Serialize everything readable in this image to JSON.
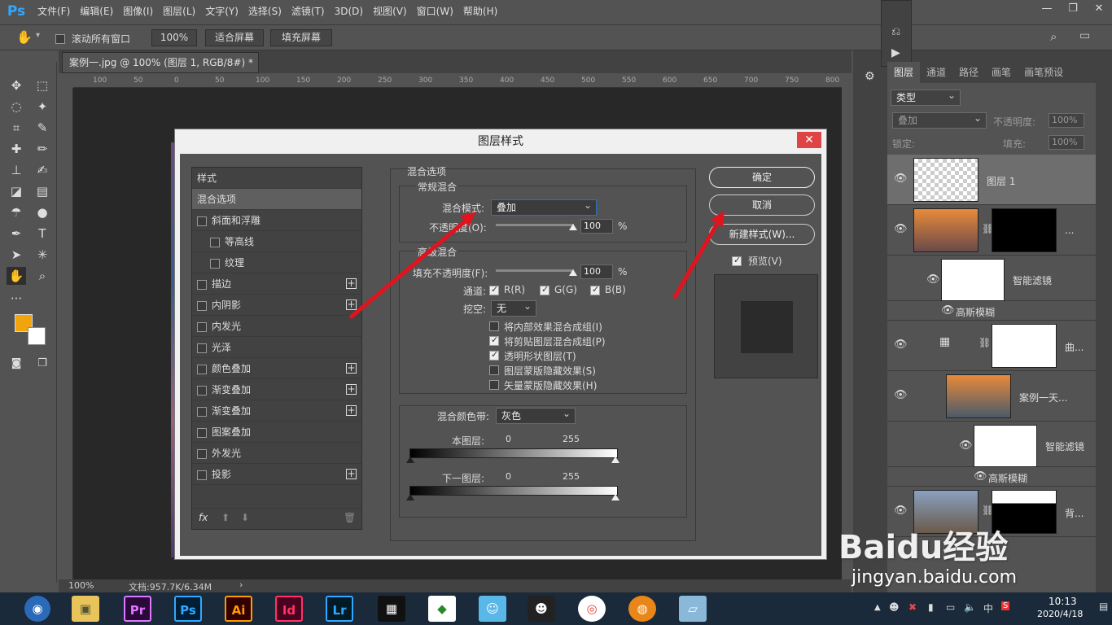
{
  "app": {
    "logo": "Ps",
    "menu": [
      "文件(F)",
      "编辑(E)",
      "图像(I)",
      "图层(L)",
      "文字(Y)",
      "选择(S)",
      "滤镜(T)",
      "3D(D)",
      "视图(V)",
      "窗口(W)",
      "帮助(H)"
    ]
  },
  "options": {
    "scroll_all": "滚动所有窗口",
    "zoom": "100%",
    "fit_screen": "适合屏幕",
    "fill_screen": "填充屏幕"
  },
  "document": {
    "tab": "案例一.jpg @ 100% (图层 1, RGB/8#) *",
    "zoom": "100%",
    "doc_size": "文档:957.7K/6.34M",
    "ruler": [
      "100",
      "50",
      "0",
      "50",
      "100",
      "150",
      "200",
      "250",
      "300",
      "350",
      "400",
      "450",
      "500",
      "550",
      "600",
      "650",
      "700",
      "750",
      "800"
    ]
  },
  "dialog": {
    "title": "图层样式",
    "close": "✕",
    "styles_header": "样式",
    "style_items": [
      {
        "label": "混合选项",
        "checkbox": false,
        "plus": false
      },
      {
        "label": "斜面和浮雕",
        "checkbox": true,
        "plus": false
      },
      {
        "label": "等高线",
        "checkbox": true,
        "plus": false
      },
      {
        "label": "纹理",
        "checkbox": true,
        "plus": false
      },
      {
        "label": "描边",
        "checkbox": true,
        "plus": true
      },
      {
        "label": "内阴影",
        "checkbox": true,
        "plus": true
      },
      {
        "label": "内发光",
        "checkbox": true,
        "plus": false
      },
      {
        "label": "光泽",
        "checkbox": true,
        "plus": false
      },
      {
        "label": "颜色叠加",
        "checkbox": true,
        "plus": true
      },
      {
        "label": "渐变叠加",
        "checkbox": true,
        "plus": true
      },
      {
        "label": "渐变叠加",
        "checkbox": true,
        "plus": true
      },
      {
        "label": "图案叠加",
        "checkbox": true,
        "plus": false
      },
      {
        "label": "外发光",
        "checkbox": true,
        "plus": false
      },
      {
        "label": "投影",
        "checkbox": true,
        "plus": true
      }
    ],
    "blend": {
      "section": "混合选项",
      "general": "常规混合",
      "mode_label": "混合模式:",
      "mode_value": "叠加",
      "opacity_label": "不透明度(O):",
      "opacity_value": "100",
      "percent": "%",
      "advanced": "高级混合",
      "fill_label": "填充不透明度(F):",
      "fill_value": "100",
      "channels_label": "通道:",
      "channel_r": "R(R)",
      "channel_g": "G(G)",
      "channel_b": "B(B)",
      "knockout_label": "挖空:",
      "knockout_value": "无",
      "opt1": "将内部效果混合成组(I)",
      "opt2": "将剪贴图层混合成组(P)",
      "opt3": "透明形状图层(T)",
      "opt4": "图层蒙版隐藏效果(S)",
      "opt5": "矢量蒙版隐藏效果(H)",
      "band_label": "混合颜色带:",
      "band_value": "灰色",
      "this_layer": "本图层:",
      "under_layer": "下一图层:",
      "min": "0",
      "max": "255"
    },
    "buttons": {
      "ok": "确定",
      "cancel": "取消",
      "new_style": "新建样式(W)...",
      "preview": "预览(V)"
    }
  },
  "layers": {
    "tabs": [
      "图层",
      "通道",
      "路径",
      "画笔",
      "画笔预设"
    ],
    "filter": "类型",
    "blend_mode": "叠加",
    "opacity_label": "不透明度:",
    "opacity": "100%",
    "lock_label": "锁定:",
    "fill_label": "填充:",
    "fill": "100%",
    "items": [
      {
        "name": "图层 1"
      },
      {
        "name": "..."
      },
      {
        "name": "智能滤镜"
      },
      {
        "name": "高斯模糊"
      },
      {
        "name": "曲..."
      },
      {
        "name": "案例一天..."
      },
      {
        "name": "智能滤镜"
      },
      {
        "name": "高斯模糊"
      },
      {
        "name": "背..."
      }
    ]
  },
  "taskbar": {
    "apps": [
      "Pr",
      "Ps",
      "Ai",
      "Id",
      "Lr"
    ],
    "time": "10:13",
    "date": "2020/4/18",
    "ime": "中"
  },
  "watermark": {
    "brand": "Baidu经验",
    "url": "jingyan.baidu.com"
  }
}
